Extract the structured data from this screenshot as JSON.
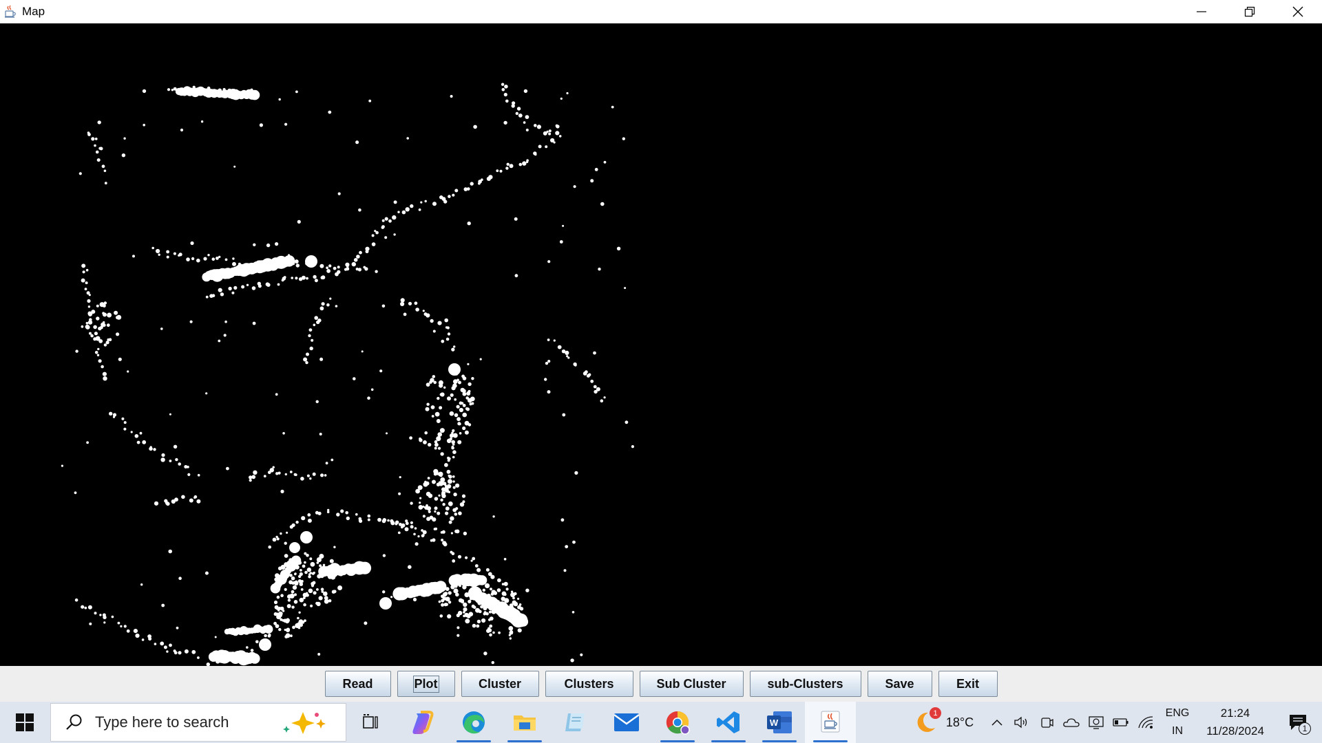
{
  "window": {
    "title": "Map",
    "icon": "java-cup-icon",
    "controls": [
      "minimize-icon",
      "restore-icon",
      "close-icon"
    ]
  },
  "buttons": [
    {
      "name": "read-button",
      "label": "Read"
    },
    {
      "name": "plot-button",
      "label": "Plot"
    },
    {
      "name": "cluster-button",
      "label": "Cluster"
    },
    {
      "name": "clusters-button",
      "label": "Clusters"
    },
    {
      "name": "sub-cluster-button",
      "label": "Sub Cluster"
    },
    {
      "name": "sub-clusters-button",
      "label": "sub-Clusters"
    },
    {
      "name": "save-button",
      "label": "Save"
    },
    {
      "name": "exit-button",
      "label": "Exit"
    }
  ],
  "canvas": {
    "background": "#000000",
    "point_color": "#ffffff"
  },
  "taskbar": {
    "search_placeholder": "Type here to search",
    "apps": [
      "task-view-icon",
      "copilot-icon",
      "edge-icon",
      "file-explorer-icon",
      "notepad-icon",
      "mail-icon",
      "chrome-icon",
      "vscode-icon",
      "word-icon",
      "java-icon"
    ],
    "weather_temp": "18°C",
    "weather_badge": "1",
    "lang_top": "ENG",
    "lang_bottom": "IN",
    "time": "21:24",
    "date": "11/28/2024",
    "notification_count": "1"
  }
}
